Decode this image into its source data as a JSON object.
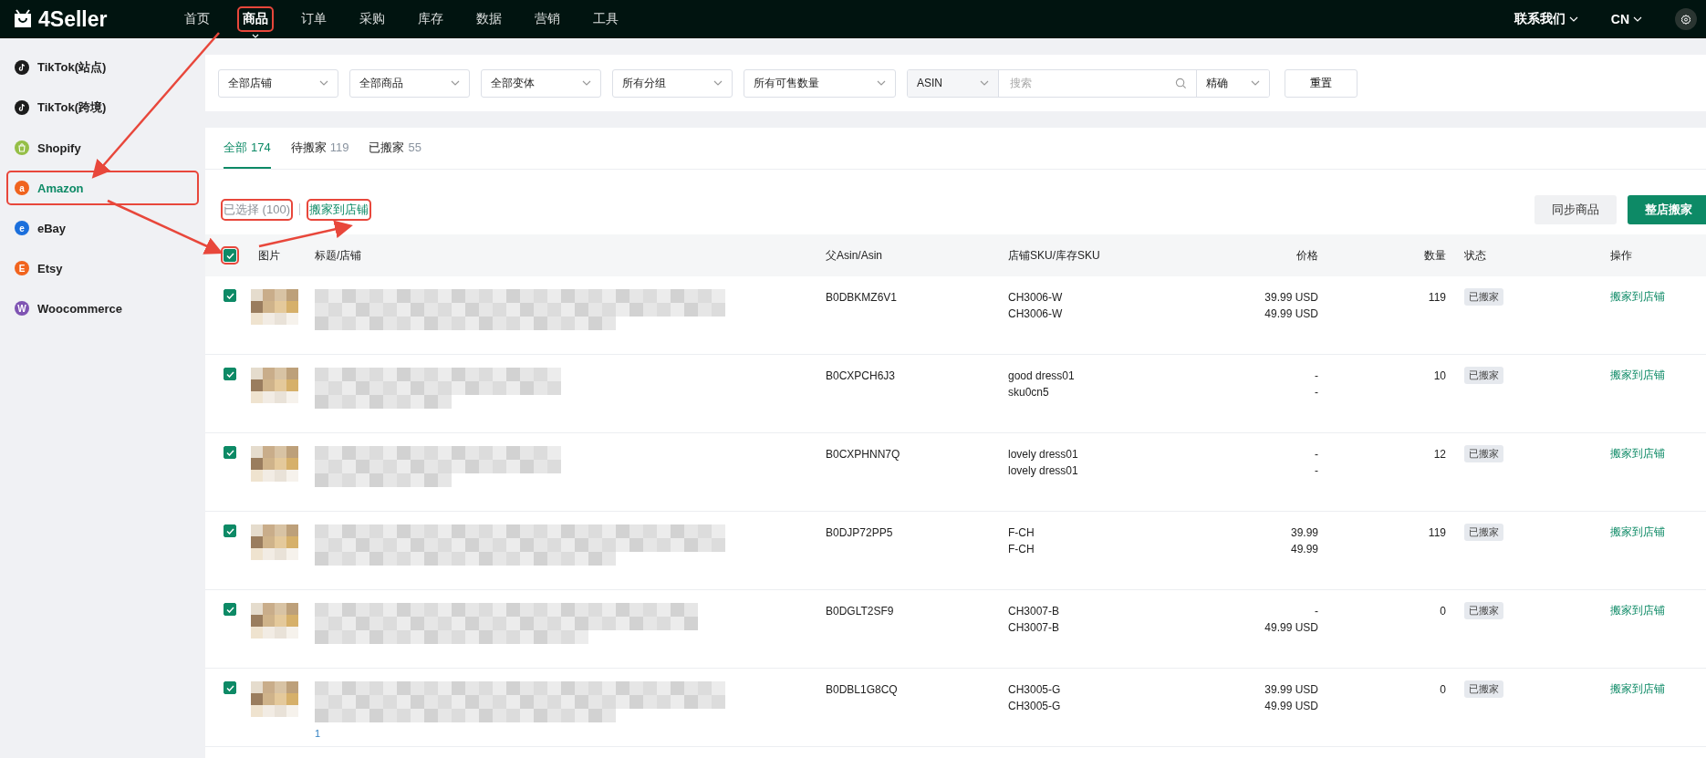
{
  "topbar": {
    "logo": "4Seller",
    "nav": [
      {
        "label": "首页",
        "selected": false,
        "annotated": false
      },
      {
        "label": "商品",
        "selected": true,
        "annotated": true
      },
      {
        "label": "订单",
        "selected": false,
        "annotated": false
      },
      {
        "label": "采购",
        "selected": false,
        "annotated": false
      },
      {
        "label": "库存",
        "selected": false,
        "annotated": false
      },
      {
        "label": "数据",
        "selected": false,
        "annotated": false
      },
      {
        "label": "营销",
        "selected": false,
        "annotated": false
      },
      {
        "label": "工具",
        "selected": false,
        "annotated": false
      }
    ],
    "contact": "联系我们",
    "language": "CN"
  },
  "sidebar": {
    "items": [
      {
        "label": "TikTok(站点)",
        "kind": "tiktok",
        "color": "#1c1c1c",
        "selected": false,
        "annotated": false
      },
      {
        "label": "TikTok(跨境)",
        "kind": "tiktok",
        "color": "#1c1c1c",
        "selected": false,
        "annotated": false
      },
      {
        "label": "Shopify",
        "kind": "shopify",
        "color": "#95bf47",
        "selected": false,
        "annotated": false
      },
      {
        "label": "Amazon",
        "kind": "letter",
        "letter": "a",
        "color": "#f0631e",
        "selected": true,
        "annotated": true
      },
      {
        "label": "eBay",
        "kind": "letter",
        "letter": "e",
        "color": "#1b6fdc",
        "selected": false,
        "annotated": false
      },
      {
        "label": "Etsy",
        "kind": "letter",
        "letter": "E",
        "color": "#f1641e",
        "selected": false,
        "annotated": false
      },
      {
        "label": "Woocommerce",
        "kind": "letter",
        "letter": "W",
        "color": "#7f54b3",
        "selected": false,
        "annotated": false
      }
    ]
  },
  "filters": {
    "selects": [
      "全部店铺",
      "全部商品",
      "全部变体",
      "所有分组",
      "所有可售数量"
    ],
    "search_type": "ASIN",
    "search": {
      "placeholder": "搜索"
    },
    "match": "精确",
    "reset": "重置"
  },
  "tabs": [
    {
      "label": "全部",
      "count": "174",
      "selected": true
    },
    {
      "label": "待搬家",
      "count": "119",
      "selected": false
    },
    {
      "label": "已搬家",
      "count": "55",
      "selected": false
    }
  ],
  "selection": {
    "label": "已选择 (100)",
    "annotated": true,
    "action": "搬家到店铺",
    "action_annotated": true
  },
  "buttons": [
    {
      "label": "同步商品",
      "kind": "secondary"
    },
    {
      "label": "整店搬家",
      "kind": "primary"
    }
  ],
  "table": {
    "select_all": {
      "checked": true,
      "annotated": true
    },
    "columns": [
      "图片",
      "标题/店铺",
      "父Asin/Asin",
      "店铺SKU/库存SKU",
      "价格",
      "数量",
      "状态",
      "操作"
    ],
    "rows": [
      {
        "checked": true,
        "asin": "B0DBKMZ6V1",
        "sku": [
          "CH3006-W",
          "CH3006-W"
        ],
        "price": [
          "39.99 USD",
          "49.99 USD"
        ],
        "qty": "119",
        "status": "已搬家",
        "action": "搬家到店铺"
      },
      {
        "checked": true,
        "asin": "B0CXPCH6J3",
        "sku": [
          "good dress01",
          "sku0cn5"
        ],
        "price": [
          "-",
          "-"
        ],
        "qty": "10",
        "status": "已搬家",
        "action": "搬家到店铺"
      },
      {
        "checked": true,
        "asin": "B0CXPHNN7Q",
        "sku": [
          "lovely dress01",
          "lovely dress01"
        ],
        "price": [
          "-",
          "-"
        ],
        "qty": "12",
        "status": "已搬家",
        "action": "搬家到店铺"
      },
      {
        "checked": true,
        "asin": "B0DJP72PP5",
        "sku": [
          "F-CH",
          "F-CH"
        ],
        "price": [
          "39.99",
          "49.99"
        ],
        "qty": "119",
        "status": "已搬家",
        "action": "搬家到店铺"
      },
      {
        "checked": true,
        "asin": "B0DGLT2SF9",
        "sku": [
          "CH3007-B",
          "CH3007-B"
        ],
        "price": [
          "-",
          "49.99 USD"
        ],
        "qty": "0",
        "status": "已搬家",
        "action": "搬家到店铺"
      },
      {
        "checked": true,
        "asin": "B0DBL1G8CQ",
        "sku": [
          "CH3005-G",
          "CH3005-G"
        ],
        "price": [
          "39.99 USD",
          "49.99 USD"
        ],
        "qty": "0",
        "status": "已搬家",
        "action": "搬家到店铺",
        "note": "1"
      }
    ]
  }
}
